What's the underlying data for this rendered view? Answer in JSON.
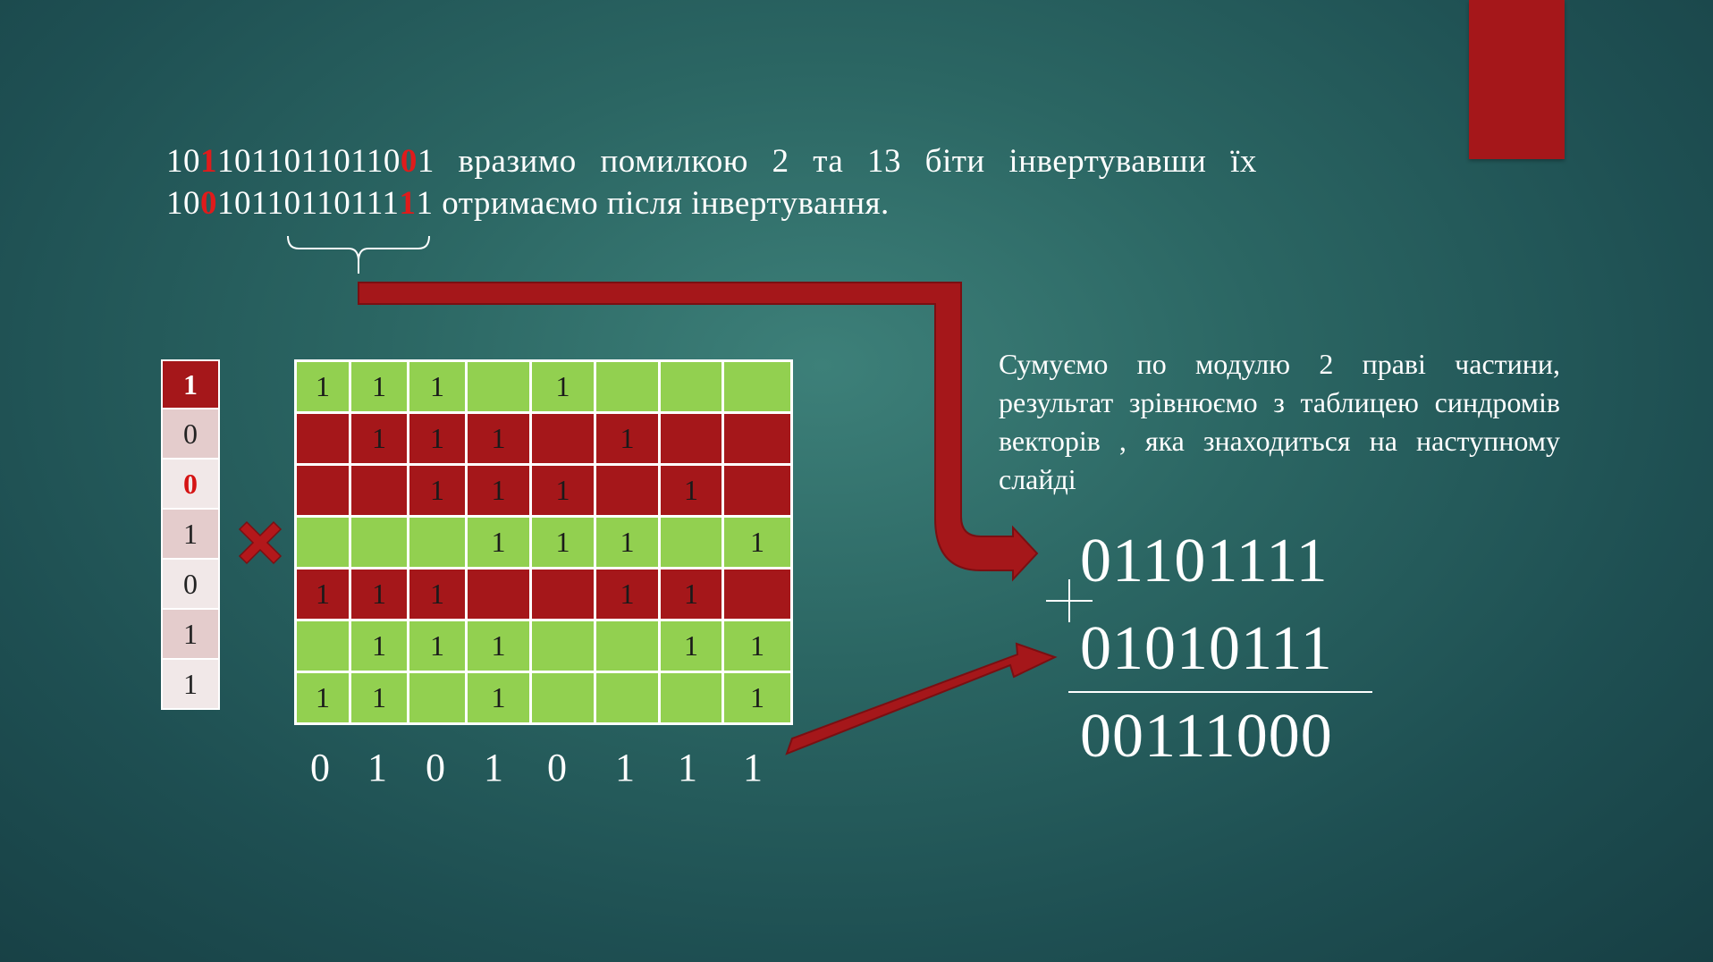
{
  "line1": {
    "bits": [
      {
        "t": "10",
        "hl": false
      },
      {
        "t": "1",
        "hl": true
      },
      {
        "t": "10110110110",
        "hl": false
      },
      {
        "t": "0",
        "hl": true
      },
      {
        "t": "1",
        "hl": false
      }
    ],
    "words": [
      "вразимо",
      "помилкою",
      "2",
      "та",
      "13",
      "біти",
      "інвертувавши",
      "їх"
    ]
  },
  "line2": {
    "bits": [
      {
        "t": "10",
        "hl": false
      },
      {
        "t": "0",
        "hl": true
      },
      {
        "t": "10110110111",
        "hl": false
      },
      {
        "t": "1",
        "hl": true
      },
      {
        "t": "1",
        "hl": false
      }
    ],
    "text": "отримаємо після інвертування."
  },
  "left_vector": [
    {
      "v": "1",
      "style": "red"
    },
    {
      "v": "0",
      "style": "pink"
    },
    {
      "v": "0",
      "style": "light",
      "hl": true
    },
    {
      "v": "1",
      "style": "pink"
    },
    {
      "v": "0",
      "style": "light"
    },
    {
      "v": "1",
      "style": "pink"
    },
    {
      "v": "1",
      "style": "light"
    }
  ],
  "matrix": [
    {
      "color": "green",
      "cells": [
        "1",
        "1",
        "1",
        "",
        "1",
        "",
        "",
        ""
      ]
    },
    {
      "color": "red",
      "cells": [
        "",
        "1",
        "1",
        "1",
        "",
        "1",
        "",
        ""
      ]
    },
    {
      "color": "red",
      "cells": [
        "",
        "",
        "1",
        "1",
        "1",
        "",
        "1",
        ""
      ]
    },
    {
      "color": "green",
      "cells": [
        "",
        "",
        "",
        "1",
        "1",
        "1",
        "",
        "1"
      ]
    },
    {
      "color": "red",
      "cells": [
        "1",
        "1",
        "1",
        "",
        "",
        "1",
        "1",
        ""
      ]
    },
    {
      "color": "green",
      "cells": [
        "",
        "1",
        "1",
        "1",
        "",
        "",
        "1",
        "1"
      ]
    },
    {
      "color": "green",
      "cells": [
        "1",
        "1",
        "",
        "1",
        "",
        "",
        "",
        "1"
      ]
    }
  ],
  "syndrome": [
    "0",
    "1",
    "0",
    "1",
    "0",
    "1",
    "1",
    "1"
  ],
  "explain": "Сумуємо по модулю 2 праві частини, результат зрівнюємо з таблицею синдромів векторів , яка знаходиться на наступному слайді",
  "sum": {
    "a": "01101111",
    "b": "01010111",
    "result": "00111000"
  },
  "icons": {
    "multiply": "multiply-x-icon",
    "plus": "plus-icon",
    "arrow_top": "bent-arrow-icon",
    "arrow_bottom": "diagonal-arrow-icon",
    "brace": "underbrace-icon"
  },
  "colors": {
    "accent_red": "#a5171a",
    "green": "#92d050",
    "highlight_red": "#e01b1b"
  }
}
